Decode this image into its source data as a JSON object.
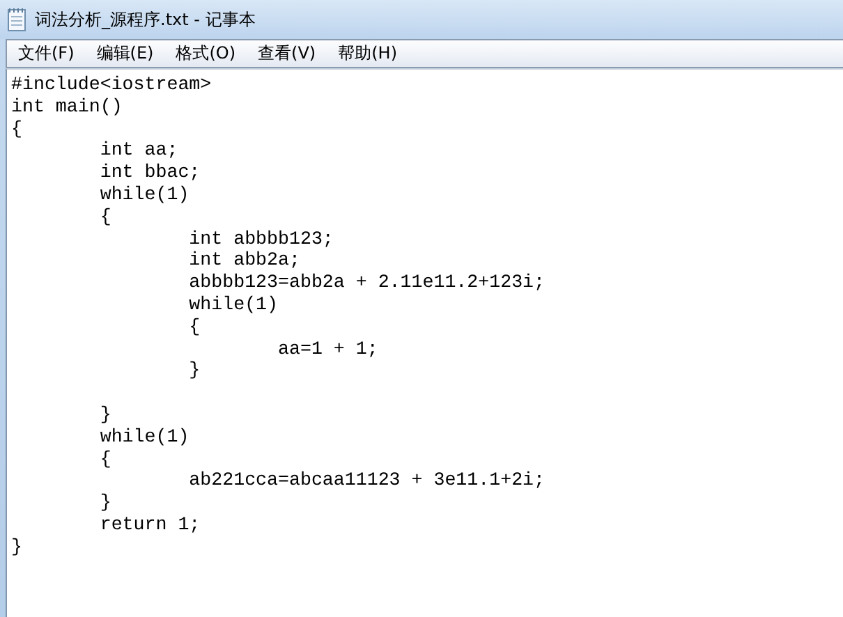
{
  "window": {
    "title": "词法分析_源程序.txt - 记事本"
  },
  "menu": [
    {
      "label": "文件(F)"
    },
    {
      "label": "编辑(E)"
    },
    {
      "label": "格式(O)"
    },
    {
      "label": "查看(V)"
    },
    {
      "label": "帮助(H)"
    }
  ],
  "editor": {
    "lines": [
      {
        "kind": "code",
        "text": "#include<iostream>"
      },
      {
        "kind": "code",
        "text": "int main()"
      },
      {
        "kind": "code",
        "text": "{"
      },
      {
        "kind": "code",
        "text": "\tint aa;"
      },
      {
        "kind": "code",
        "text": "\tint bbac;"
      },
      {
        "kind": "code",
        "text": "\twhile(1)"
      },
      {
        "kind": "code",
        "text": "\t{"
      },
      {
        "kind": "code",
        "text": "\t\tint abbbb123;"
      },
      {
        "kind": "code",
        "text": "\t\tint abb2a;"
      },
      {
        "kind": "code",
        "text": "\t\tabbbb123=abb2a + 2.11e11.2+123i;"
      },
      {
        "kind": "code",
        "text": "\t\twhile(1)"
      },
      {
        "kind": "code",
        "text": "\t\t{"
      },
      {
        "kind": "code",
        "text": "\t\t\taa=1 + 1;"
      },
      {
        "kind": "code",
        "text": "\t\t}"
      },
      {
        "kind": "blank"
      },
      {
        "kind": "code",
        "text": "\t}"
      },
      {
        "kind": "code",
        "text": "\twhile(1)"
      },
      {
        "kind": "code",
        "text": "\t{"
      },
      {
        "kind": "code",
        "text": "\t\tab221cca=abcaa11123 + 3e11.1+2i;"
      },
      {
        "kind": "code",
        "text": "\t}"
      },
      {
        "kind": "code",
        "text": "\treturn 1;"
      },
      {
        "kind": "code",
        "text": "}"
      }
    ]
  }
}
